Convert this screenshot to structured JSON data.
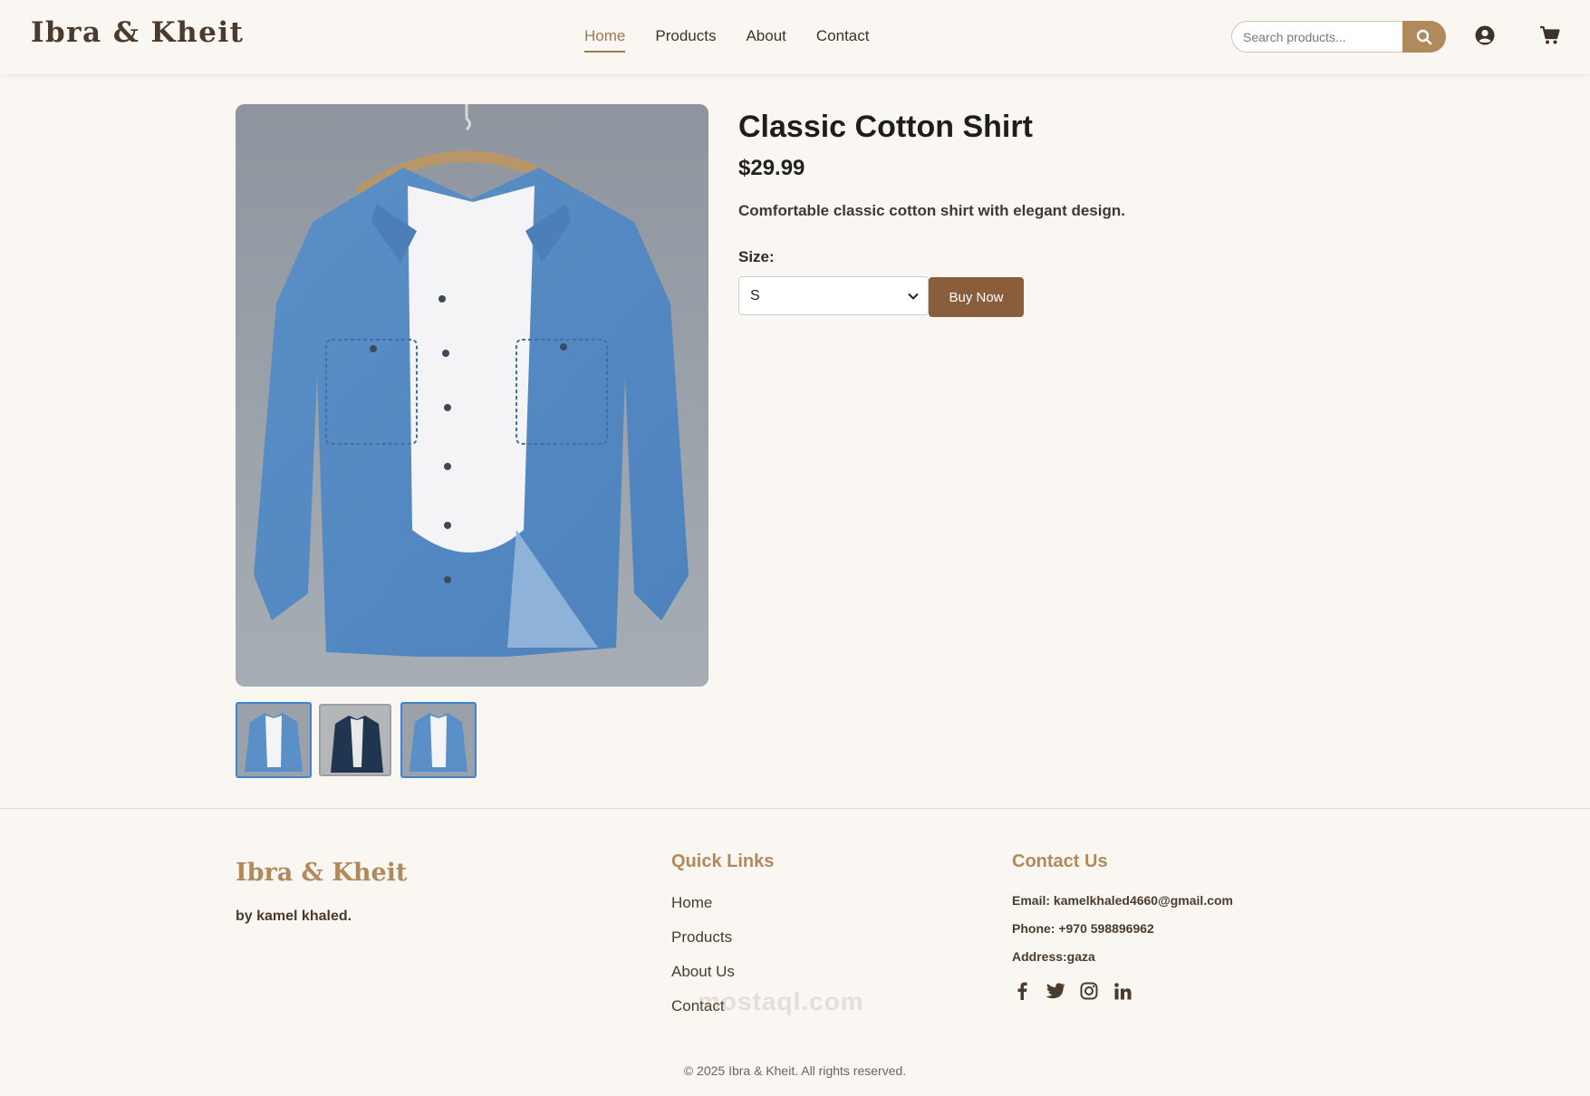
{
  "header": {
    "brand": "Ibra & Kheit",
    "nav": [
      "Home",
      "Products",
      "About",
      "Contact"
    ],
    "active_nav": "Home",
    "search_placeholder": "Search products..."
  },
  "product": {
    "title": "Classic Cotton Shirt",
    "price": "$29.99",
    "description": "Comfortable classic cotton shirt with elegant design.",
    "size_label": "Size:",
    "selected_size": "S",
    "buy_label": "Buy Now",
    "thumbnails": [
      "light-denim-front",
      "dark-denim-hanger",
      "light-denim-front"
    ]
  },
  "footer": {
    "brand": "Ibra & Kheit",
    "by": "by kamel khaled.",
    "quick_links_title": "Quick Links",
    "quick_links": [
      "Home",
      "Products",
      "About Us",
      "Contact"
    ],
    "contact_title": "Contact Us",
    "email": "Email: kamelkhaled4660@gmail.com",
    "phone": "Phone: +970 598896962",
    "address": "Address:gaza",
    "socials": [
      "facebook-icon",
      "twitter-icon",
      "instagram-icon",
      "linkedin-icon"
    ],
    "watermark": "mostaql.com",
    "copyright": "© 2025 Ibra & Kheit. All rights reserved."
  },
  "colors": {
    "background": "#faf6f2",
    "accent": "#b08a5c",
    "button": "#8a5e3b",
    "thumb_selected": "#3d84d6"
  }
}
